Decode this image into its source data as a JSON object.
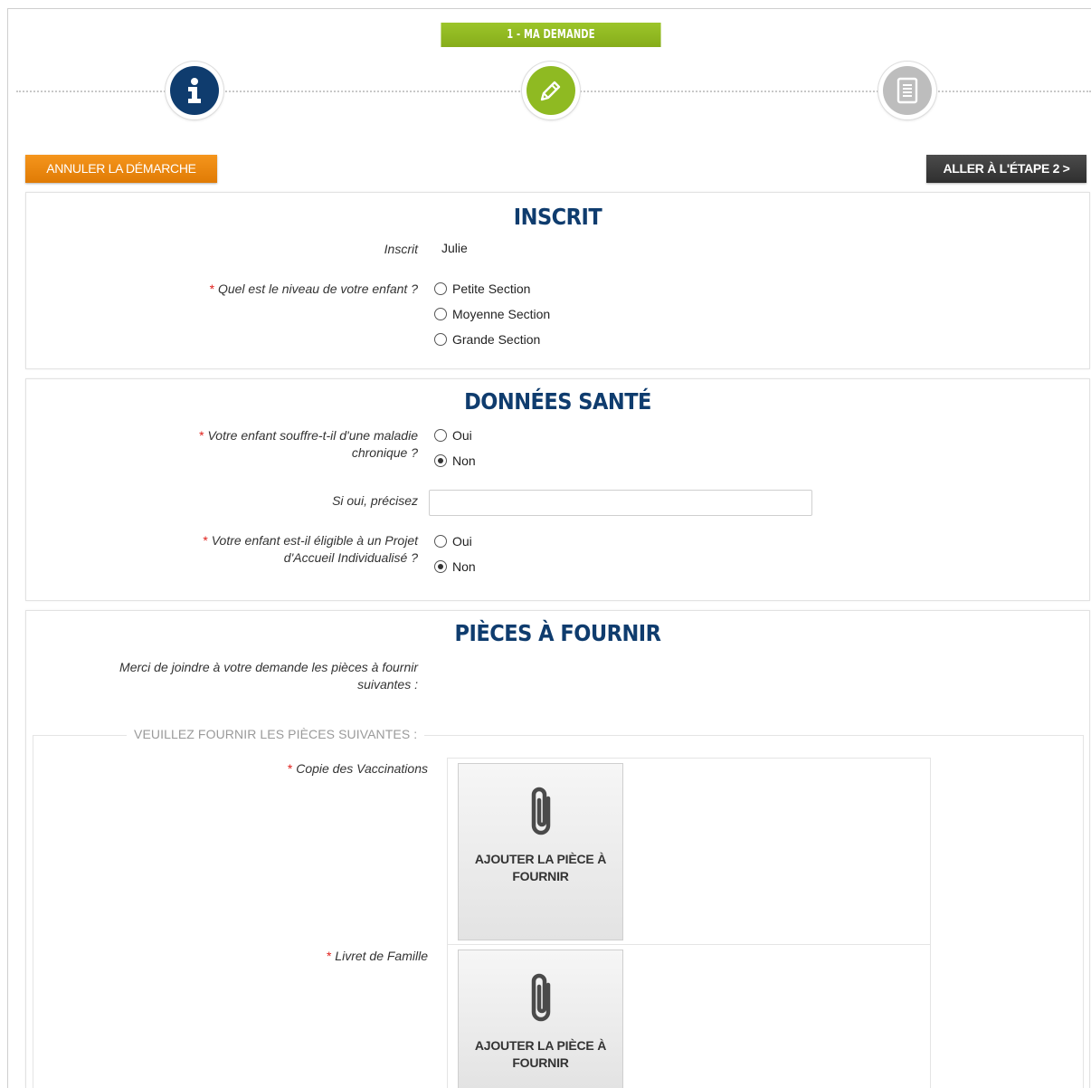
{
  "stepper": {
    "current_step_label": "1 - MA DEMANDE",
    "steps": [
      {
        "icon": "info-icon",
        "state": "done",
        "color": "#0f3c6e"
      },
      {
        "icon": "pencil-icon",
        "state": "active",
        "color": "#8fba22"
      },
      {
        "icon": "document-icon",
        "state": "todo",
        "color": "#bdbdbd"
      }
    ]
  },
  "actions": {
    "cancel_label": "ANNULER LA DÉMARCHE",
    "cancel_color": "#f08a12",
    "next_label": "ALLER À L'ÉTAPE 2 >",
    "next_color": "#3a3a3a"
  },
  "inscrit": {
    "title": "INSCRIT",
    "inscrit_label": "Inscrit",
    "inscrit_value": "Julie",
    "niveau_question": "Quel est le niveau de votre enfant ?",
    "niveau_options": [
      "Petite Section",
      "Moyenne Section",
      "Grande Section"
    ],
    "niveau_selected": null
  },
  "sante": {
    "title": "DONNÉES SANTÉ",
    "maladie_question": "Votre enfant souffre-t-il d'une maladie chronique ?",
    "maladie_options": [
      "Oui",
      "Non"
    ],
    "maladie_selected": "Non",
    "precisez_label": "Si oui, précisez",
    "precisez_value": "",
    "pai_question": "Votre enfant est-il éligible à un Projet d'Accueil Individualisé ?",
    "pai_options": [
      "Oui",
      "Non"
    ],
    "pai_selected": "Non"
  },
  "pieces": {
    "title": "PIÈCES À FOURNIR",
    "intro": "Merci de joindre à votre demande les pièces à fournir suivantes :",
    "legend": "VEUILLEZ FOURNIR LES PIÈCES SUIVANTES :",
    "documents": [
      {
        "label": "Copie des Vaccinations",
        "upload_label": "AJOUTER LA PIÈCE À FOURNIR"
      },
      {
        "label": "Livret de Famille",
        "upload_label": "AJOUTER LA PIÈCE À FOURNIR"
      }
    ]
  },
  "required_marker": "*",
  "colors": {
    "title_blue": "#0f3c6e",
    "required_red": "#e0201b",
    "green": "#8fba22"
  }
}
